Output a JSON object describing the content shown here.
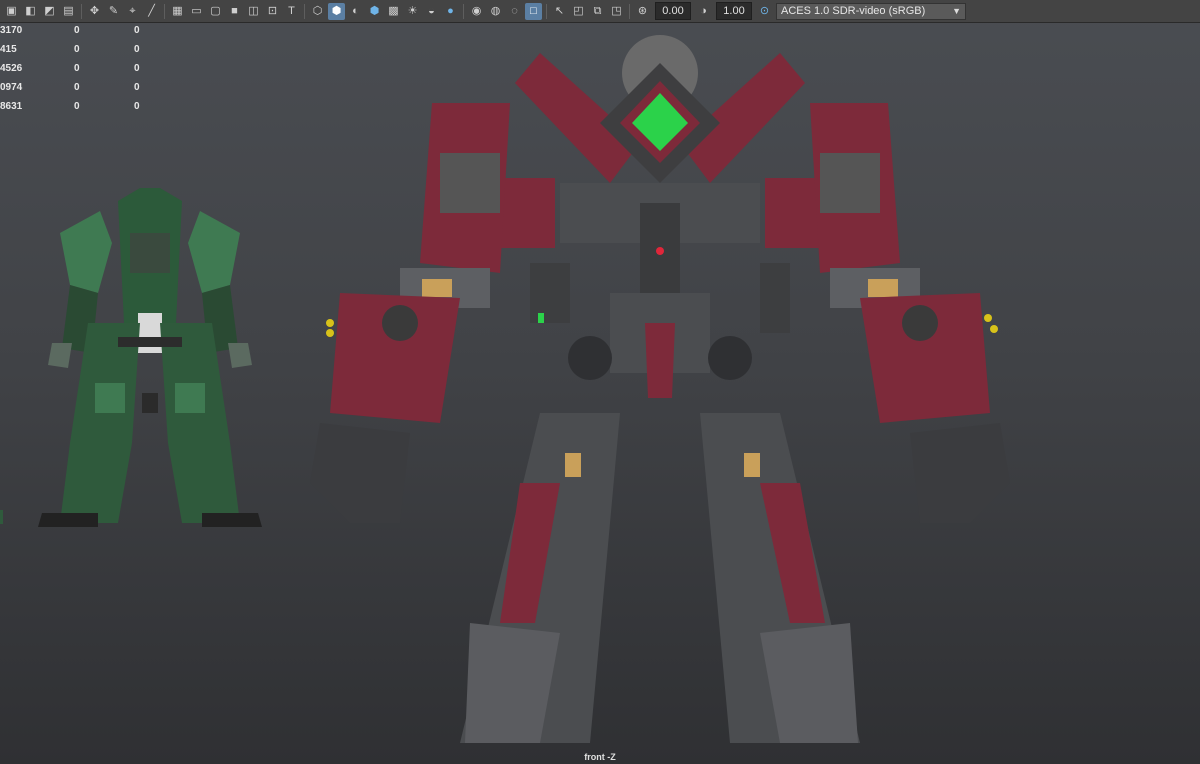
{
  "toolbar": {
    "exposure_value": "0.00",
    "gamma_value": "1.00",
    "color_management": "ACES 1.0 SDR-video (sRGB)",
    "icons": [
      "select-camera-icon",
      "camera-attributes-icon",
      "bookmark-icon",
      "image-plane-icon",
      "2d-pan-zoom-icon",
      "grease-pencil-icon",
      "grid-icon",
      "film-gate-icon",
      "resolution-gate-icon",
      "gate-mask-icon",
      "field-chart-icon",
      "safe-action-icon",
      "safe-title-icon",
      "wireframe-icon",
      "smooth-shade-icon",
      "default-material-icon",
      "shaded-wireframe-icon",
      "use-all-lights-icon",
      "shadows-icon",
      "screen-space-ao-icon",
      "motion-blur-icon",
      "multisample-aa-icon",
      "depth-of-field-icon",
      "isolate-select-icon",
      "xray-icon",
      "xray-active-icon",
      "xray-joints-icon",
      "exposure-icon",
      "gamma-icon",
      "color-management-icon"
    ]
  },
  "hud": {
    "rows": [
      {
        "c0": "3170",
        "c1": "0",
        "c2": "0"
      },
      {
        "c0": "415",
        "c1": "0",
        "c2": "0"
      },
      {
        "c0": "4526",
        "c1": "0",
        "c2": "0"
      },
      {
        "c0": "0974",
        "c1": "0",
        "c2": "0"
      },
      {
        "c0": "8631",
        "c1": "0",
        "c2": "0"
      }
    ]
  },
  "viewport": {
    "camera_label": "front -Z",
    "colors": {
      "bg_top": "#4a4d52",
      "bg_bottom": "#2f3033",
      "mech_red": "#7d2a3a",
      "mech_grey": "#4b4d50",
      "mech_green": "#2f5a3c",
      "accent_green": "#2bd24a",
      "accent_yellow": "#d8c21a"
    }
  }
}
